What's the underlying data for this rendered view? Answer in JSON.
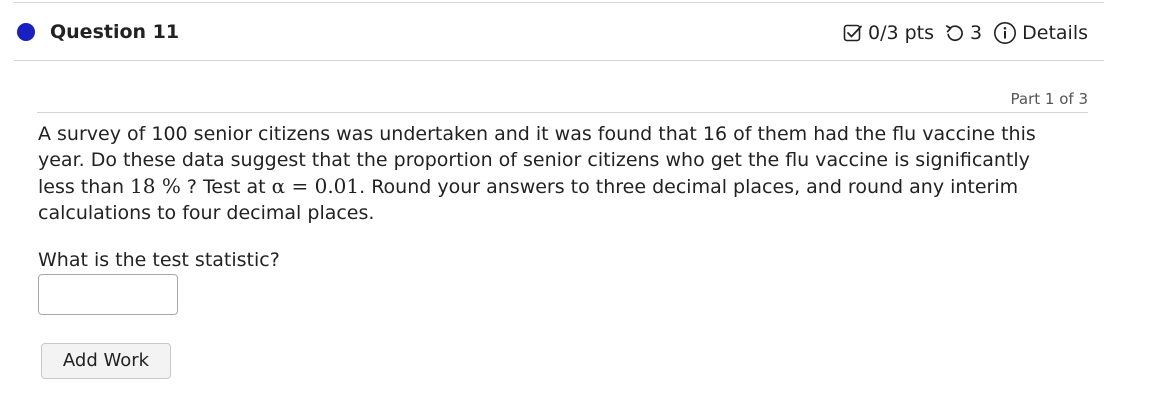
{
  "question": {
    "title": "Question 11",
    "score": "0/3 pts",
    "attempts": "3",
    "details_label": "Details",
    "part": "Part 1 of 3"
  },
  "icons": {
    "status": "filled-circle-icon",
    "score": "checkbox-icon",
    "attempts": "retry-icon",
    "details": "info-icon"
  },
  "colors": {
    "status_dot": "#1a1fbf",
    "text": "#222222",
    "muted": "#555555",
    "rule": "#d4d4d4"
  },
  "body": {
    "text_1": "A survey of 100 senior citizens was undertaken and it was found that 16 of them had the flu vaccine this year. Do these data suggest that the proportion of senior citizens who get the flu vaccine is significantly less than ",
    "math_1": "18 %",
    "text_2": " ? Test at ",
    "math_2": "α = 0.01",
    "text_3": ". Round your answers to three decimal places, and round any interim calculations to four decimal places."
  },
  "prompt": "What is the test statistic?",
  "answer": {
    "value": "",
    "placeholder": ""
  },
  "add_work_label": "Add Work"
}
